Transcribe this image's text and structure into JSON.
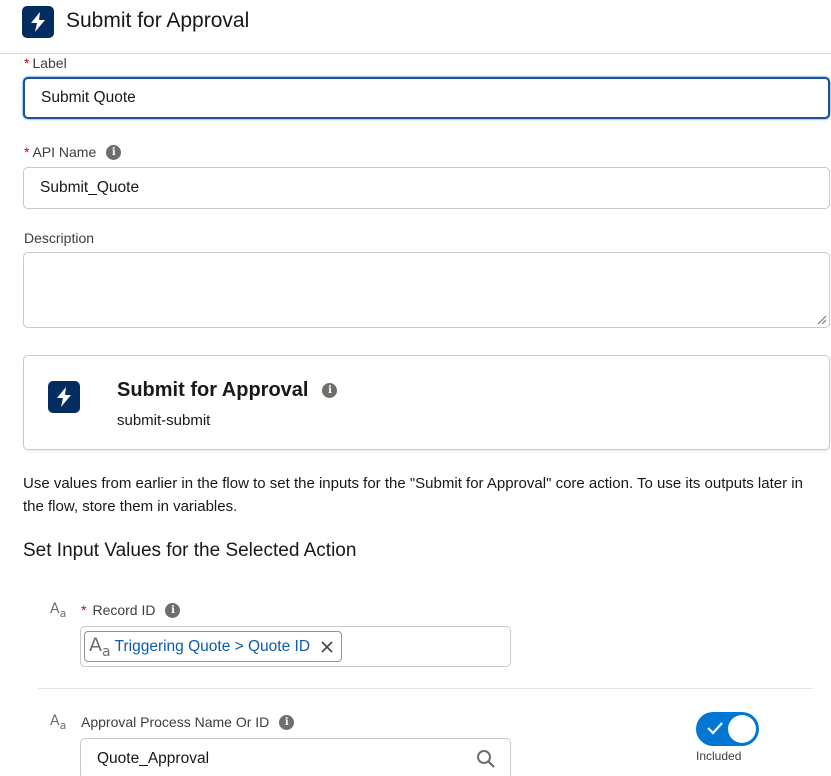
{
  "header": {
    "title": "Submit for Approval",
    "icon": "lightning-bolt-icon",
    "icon_bg": "#032d60"
  },
  "label_field": {
    "required_marker": "*",
    "label": "Label",
    "value": "Submit Quote"
  },
  "api_name_field": {
    "required_marker": "*",
    "label": "API Name",
    "value": "Submit_Quote"
  },
  "description_field": {
    "label": "Description",
    "value": ""
  },
  "action_card": {
    "title": "Submit for Approval",
    "subtitle": "submit-submit",
    "icon": "lightning-bolt-icon"
  },
  "help_text": "Use values from earlier in the flow to set the inputs for the \"Submit for Approval\" core action. To use its outputs later in the flow, store them in variables.",
  "section_title": "Set Input Values for the Selected Action",
  "params": {
    "record_id": {
      "type_icon": "A",
      "type_icon_sub": "a",
      "required_marker": "*",
      "label": "Record ID",
      "pill_text": "Triggering Quote > Quote ID"
    },
    "approval_process": {
      "type_icon": "A",
      "type_icon_sub": "a",
      "label": "Approval Process Name Or ID",
      "value": "Quote_Approval",
      "toggle_label": "Included",
      "toggle_on": true
    }
  },
  "colors": {
    "brand_blue": "#0176d3",
    "focus_border": "#1b5297",
    "required_red": "#ba0517",
    "link_blue": "#0b5cab"
  }
}
